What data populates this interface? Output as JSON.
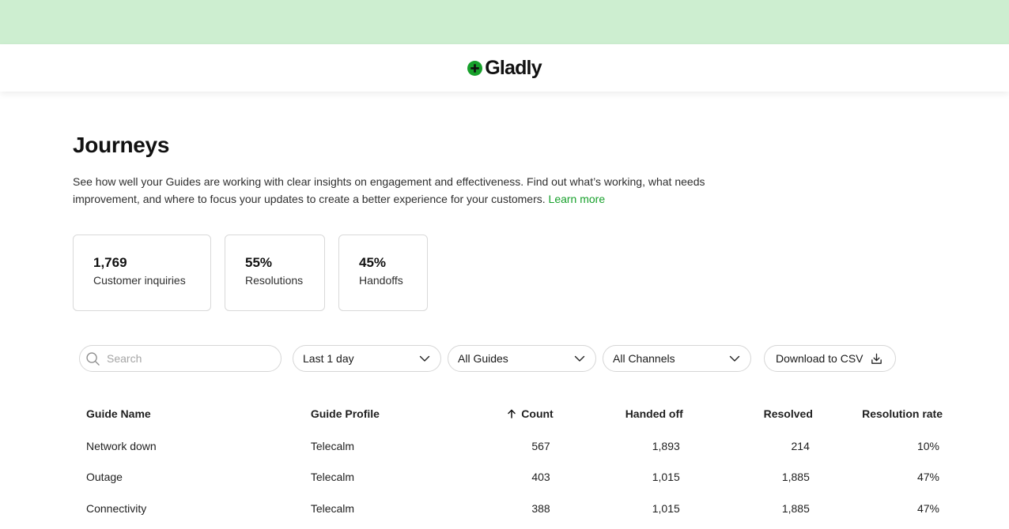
{
  "brand": {
    "name": "Gladly",
    "accent": "#17a02b",
    "top_band": "#cdeed0"
  },
  "page": {
    "title": "Journeys",
    "description": "See how well your Guides are working with clear insights on engagement and effectiveness. Find out what’s working, what needs improvement, and where to focus your updates to create a better experience for your customers.",
    "learn_more": "Learn more"
  },
  "stats": [
    {
      "value": "1,769",
      "label": "Customer inquiries"
    },
    {
      "value": "55%",
      "label": "Resolutions"
    },
    {
      "value": "45%",
      "label": "Handoffs"
    }
  ],
  "filters": {
    "search_placeholder": "Search",
    "date": "Last 1 day",
    "guides": "All Guides",
    "channels": "All Channels",
    "download": "Download to CSV"
  },
  "table": {
    "headers": {
      "guide_name": "Guide Name",
      "guide_profile": "Guide Profile",
      "count": "Count",
      "handed_off": "Handed off",
      "resolved": "Resolved",
      "resolution_rate": "Resolution rate"
    },
    "sort_icon": "arrow-up-icon",
    "rows": [
      {
        "name": "Network down",
        "profile": "Telecalm",
        "count": "567",
        "handed_off": "1,893",
        "resolved": "214",
        "rate": "10%"
      },
      {
        "name": "Outage",
        "profile": "Telecalm",
        "count": "403",
        "handed_off": "1,015",
        "resolved": "1,885",
        "rate": "47%"
      },
      {
        "name": "Connectivity",
        "profile": "Telecalm",
        "count": "388",
        "handed_off": "1,015",
        "resolved": "1,885",
        "rate": "47%"
      }
    ]
  }
}
